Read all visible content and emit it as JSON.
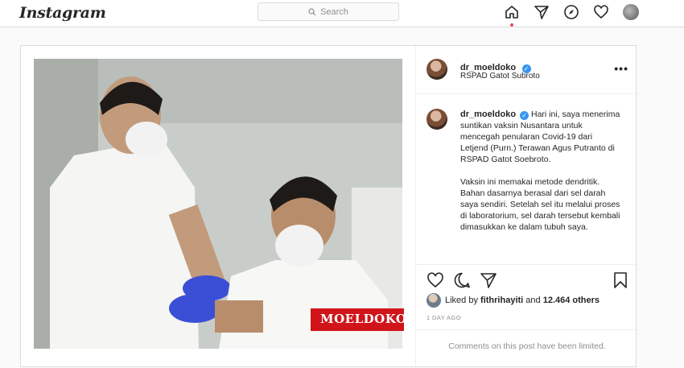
{
  "nav": {
    "logo": "Instagram",
    "search_placeholder": "Search",
    "icons": [
      "home-icon",
      "direct-icon",
      "explore-icon",
      "activity-heart-icon",
      "profile-avatar"
    ]
  },
  "post": {
    "username": "dr_moeldoko",
    "location": "RSPAD Gatot Subroto",
    "more": "•••",
    "watermark": "MOELDOKO",
    "caption_username": "dr_moeldoko",
    "caption_p1": "Hari ini, saya menerima suntikan vaksin Nusantara untuk mencegah penularan Covid-19 dari Letjend (Purn.) Terawan Agus Putranto di RSPAD Gatot Soebroto.",
    "caption_p2": "Vaksin ini memakai metode dendritik. Bahan dasarnya berasal dari sel darah saya sendiri. Setelah sel itu melalui proses di laboratorium, sel darah tersebut kembali dimasukkan ke dalam tubuh saya.",
    "likes_prefix": "Liked by",
    "likes_user": "fithrihayiti",
    "likes_and": "and",
    "likes_count": "12.464 others",
    "time": "1 DAY AGO",
    "comments_limited": "Comments on this post have been limited."
  },
  "colors": {
    "accent": "#3897f0",
    "notification": "#ed4956",
    "watermark": "#d0141a"
  }
}
